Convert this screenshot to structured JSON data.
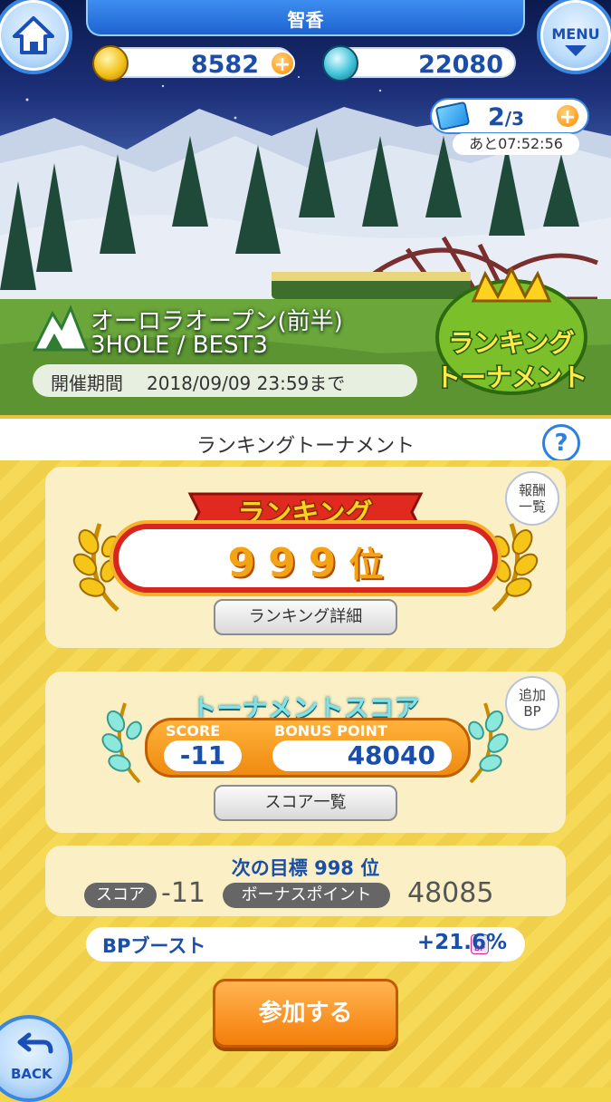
{
  "header": {
    "player_name": "智香",
    "menu_label": "MENU",
    "coins": "8582",
    "crowns": "22080",
    "tickets_current": "2",
    "tickets_max": "3",
    "ticket_timer": "あと07:52:56"
  },
  "course": {
    "name": "オーロラオープン(前半)",
    "format": "3HOLE / BEST3",
    "period_label": "開催期間",
    "period_value": "2018/09/09 23:59まで",
    "emblem_line1": "ランキング",
    "emblem_line2": "トーナメント"
  },
  "section_title": "ランキングトーナメント",
  "help_label": "?",
  "ranking": {
    "ribbon_label": "ランキング",
    "rank": "999",
    "rank_suffix": "位",
    "reward_btn_line1": "報酬",
    "reward_btn_line2": "一覧",
    "detail_btn": "ランキング詳細"
  },
  "tournament_score": {
    "title": "トーナメントスコア",
    "score_label": "SCORE",
    "score_value": "-11",
    "bonus_label": "BONUS POINT",
    "bonus_value": "48040",
    "addbp_line1": "追加",
    "addbp_line2": "BP",
    "list_btn": "スコア一覧"
  },
  "next_goal": {
    "title": "次の目標 998 位",
    "score_chip": "スコア",
    "score_value": "-11",
    "bonus_chip": "ボーナスポイント",
    "bonus_value": "48085"
  },
  "boost": {
    "label": "BPブースト",
    "icon_text": "BP",
    "value": "+21.6%"
  },
  "join_btn": "参加する",
  "back_btn": "BACK",
  "colors": {
    "accent_blue": "#1a4ea8",
    "orange": "#f47e09",
    "yellow_bg": "#f3d54a"
  }
}
